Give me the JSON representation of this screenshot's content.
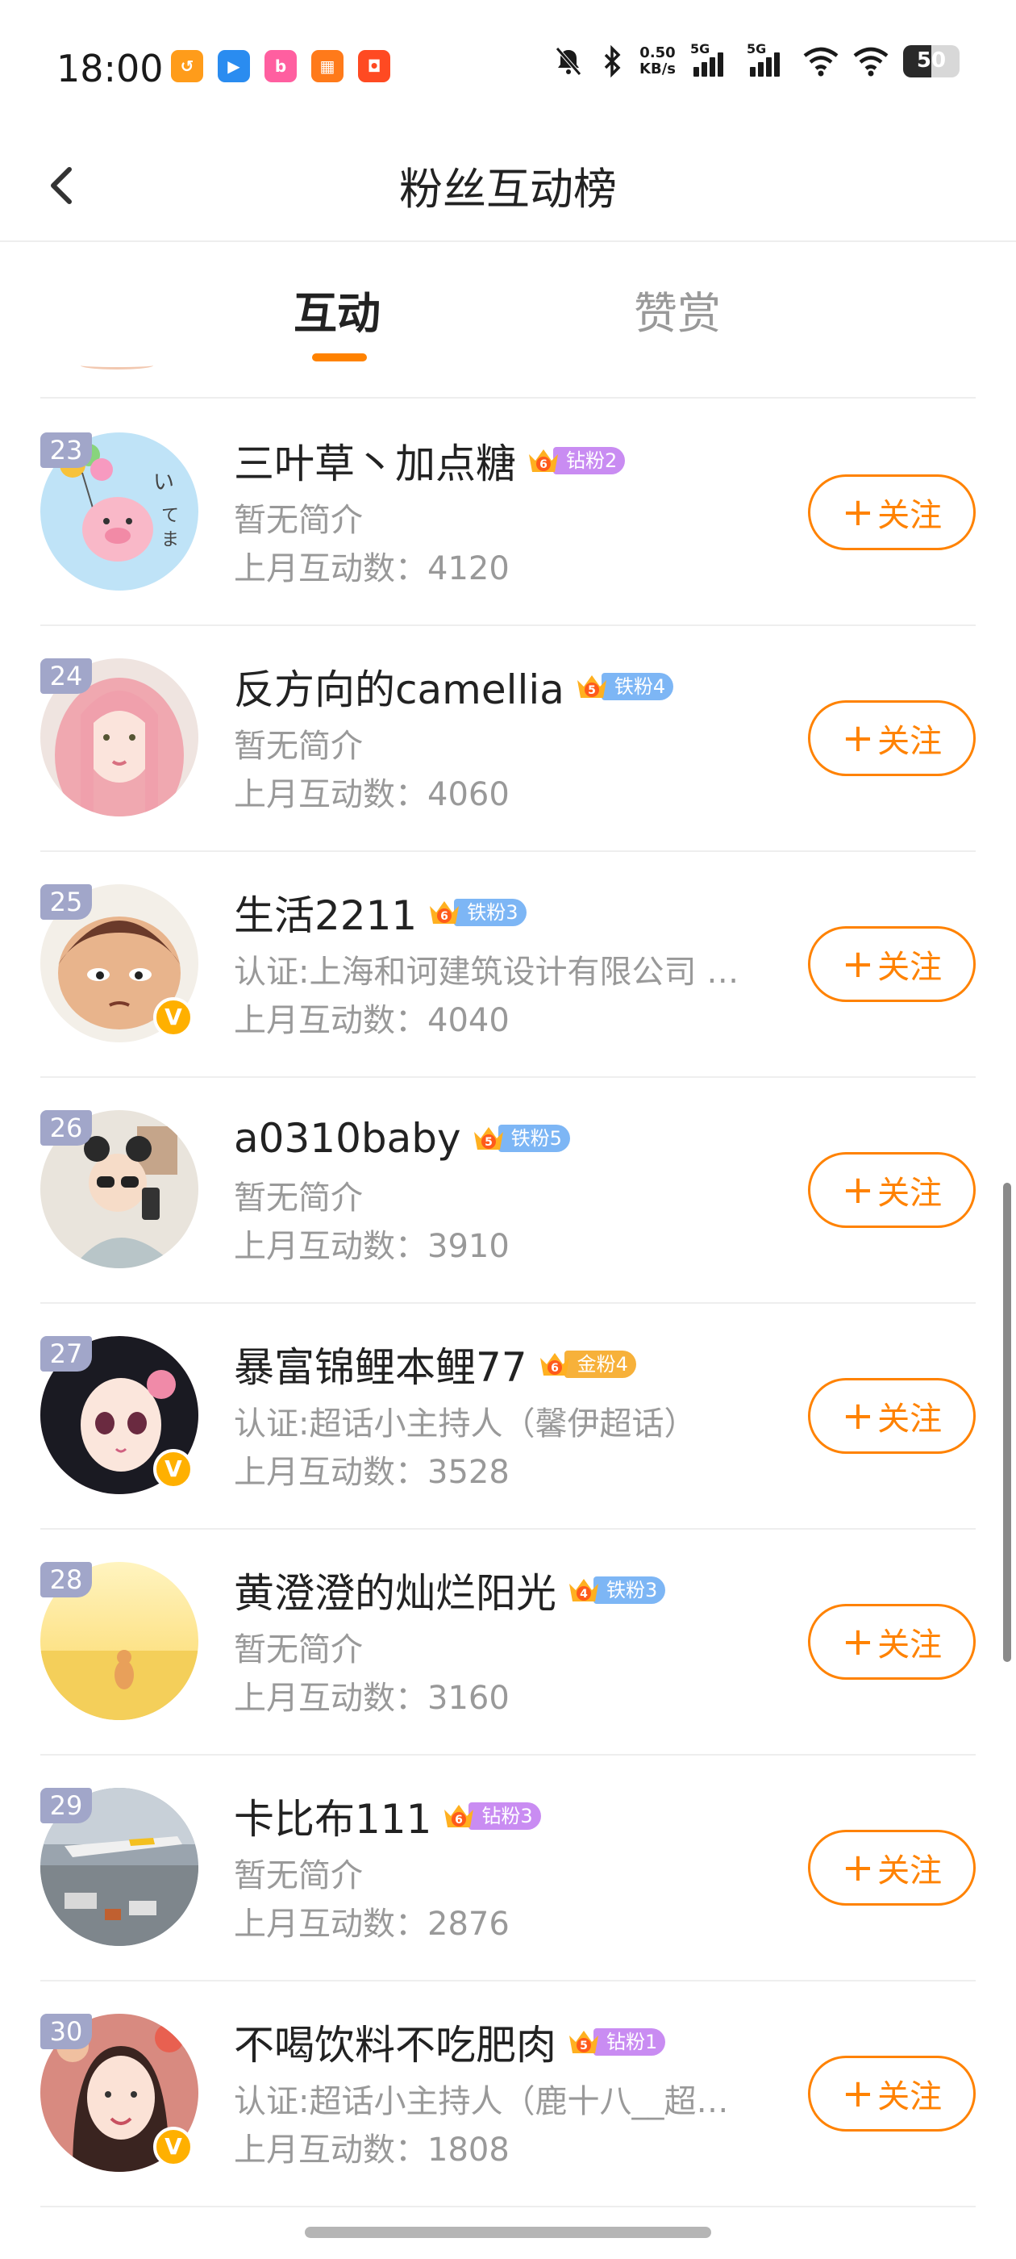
{
  "status": {
    "time": "18:00",
    "net_speed_value": "0.50",
    "net_speed_unit": "KB/s",
    "signal1_label": "5G",
    "signal2_label": "5G",
    "battery": "50",
    "battery_level": 0.5,
    "app_icons": [
      {
        "icon": "app-a-icon",
        "color": "#ff9c1a",
        "glyph": "↺"
      },
      {
        "icon": "app-b-icon",
        "color": "#2a8cf0",
        "glyph": "▶"
      },
      {
        "icon": "app-c-icon",
        "color": "#ff5fa0",
        "glyph": "b"
      },
      {
        "icon": "app-d-icon",
        "color": "#ff7a1a",
        "glyph": "▦"
      },
      {
        "icon": "app-e-icon",
        "color": "#ff4a22",
        "glyph": "◘"
      }
    ]
  },
  "header": {
    "title": "粉丝互动榜"
  },
  "tabs": {
    "active": "互动",
    "inactive": "赞赏"
  },
  "colors": {
    "accent": "#ff8200",
    "rank_badge": "#a1a6c9",
    "fan_diamond": "#c98cf2",
    "fan_iron": "#7db6f5",
    "fan_gold": "#f7b13a"
  },
  "follow_label": "关注",
  "rows": [
    {
      "rank": "23",
      "name": "三叶草丶加点糖",
      "crown_level": "6",
      "fan_label": "钻粉2",
      "fan_type": "diamond",
      "bio": "暂无简介",
      "count_label": "上月互动数：",
      "count": "4120",
      "verified": false,
      "avatar": "pink-pig-illustration"
    },
    {
      "rank": "24",
      "name": "反方向的camellia",
      "crown_level": "5",
      "fan_label": "铁粉4",
      "fan_type": "iron",
      "bio": "暂无简介",
      "count_label": "上月互动数：",
      "count": "4060",
      "verified": false,
      "avatar": "pink-hair-girl"
    },
    {
      "rank": "25",
      "name": "生活2211",
      "crown_level": "6",
      "fan_label": "铁粉3",
      "fan_type": "iron",
      "bio": "认证:上海和诃建筑设计有限公司 …",
      "count_label": "上月互动数：",
      "count": "4040",
      "verified": true,
      "avatar": "cartoon-kid"
    },
    {
      "rank": "26",
      "name": "a0310baby",
      "crown_level": "5",
      "fan_label": "铁粉5",
      "fan_type": "iron",
      "bio": "暂无简介",
      "count_label": "上月互动数：",
      "count": "3910",
      "verified": false,
      "avatar": "girl-selfie"
    },
    {
      "rank": "27",
      "name": "暴富锦鲤本鲤77",
      "crown_level": "6",
      "fan_label": "金粉4",
      "fan_type": "gold",
      "bio": "认证:超话小主持人（馨伊超话）",
      "count_label": "上月互动数：",
      "count": "3528",
      "verified": true,
      "avatar": "anime-girl"
    },
    {
      "rank": "28",
      "name": "黄澄澄的灿烂阳光",
      "crown_level": "4",
      "fan_label": "铁粉3",
      "fan_type": "iron",
      "bio": "暂无简介",
      "count_label": "上月互动数：",
      "count": "3160",
      "verified": false,
      "avatar": "sunny-field"
    },
    {
      "rank": "29",
      "name": "卡比布111",
      "crown_level": "6",
      "fan_label": "钻粉3",
      "fan_type": "diamond",
      "bio": "暂无简介",
      "count_label": "上月互动数：",
      "count": "2876",
      "verified": false,
      "avatar": "airport-plane"
    },
    {
      "rank": "30",
      "name": "不喝饮料不吃肥肉",
      "crown_level": "5",
      "fan_label": "钻粉1",
      "fan_type": "diamond",
      "bio": "认证:超话小主持人（鹿十八__超…",
      "count_label": "上月互动数：",
      "count": "1808",
      "verified": true,
      "avatar": "girl-portrait"
    }
  ]
}
